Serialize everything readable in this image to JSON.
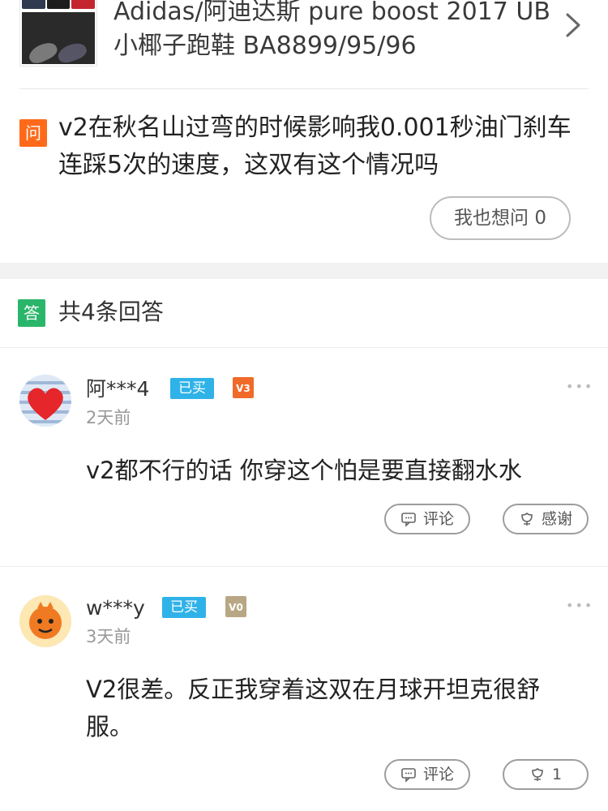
{
  "product": {
    "title": "Adidas/阿迪达斯 pure boost 2017 UB小椰子跑鞋 BA8899/95/96"
  },
  "question": {
    "badge": "问",
    "text": "v2在秋名山过弯的时候影响我0.001秒油门刹车连踩5次的速度，这双有这个情况吗",
    "ask_button": "我也想问 0"
  },
  "answers_header": {
    "badge": "答",
    "count_label": "共4条回答"
  },
  "answers": [
    {
      "username": "阿***4",
      "bought_badge": "已买",
      "level_badge": "V3",
      "time": "2天前",
      "content": "v2都不行的话 你穿这个怕是要直接翻水水",
      "comment_label": "评论",
      "thanks_label": "感谢",
      "more": "•••"
    },
    {
      "username": "w***y",
      "bought_badge": "已买",
      "level_badge": "V0",
      "time": "3天前",
      "content": "V2很差。反正我穿着这双在月球开坦克很舒服。",
      "comment_label": "评论",
      "thanks_label": "1",
      "more": "•••"
    }
  ],
  "colors": {
    "question_badge": "#ff6a1a",
    "answer_badge": "#2ab66a",
    "bought_badge": "#2fb2e8",
    "level_v3": "#f06a2a",
    "level_v0": "#b8a784"
  },
  "icons": {
    "chevron": "chevron-right-icon",
    "comment": "comment-icon",
    "thanks": "flower-thanks-icon",
    "like": "like-icon"
  }
}
